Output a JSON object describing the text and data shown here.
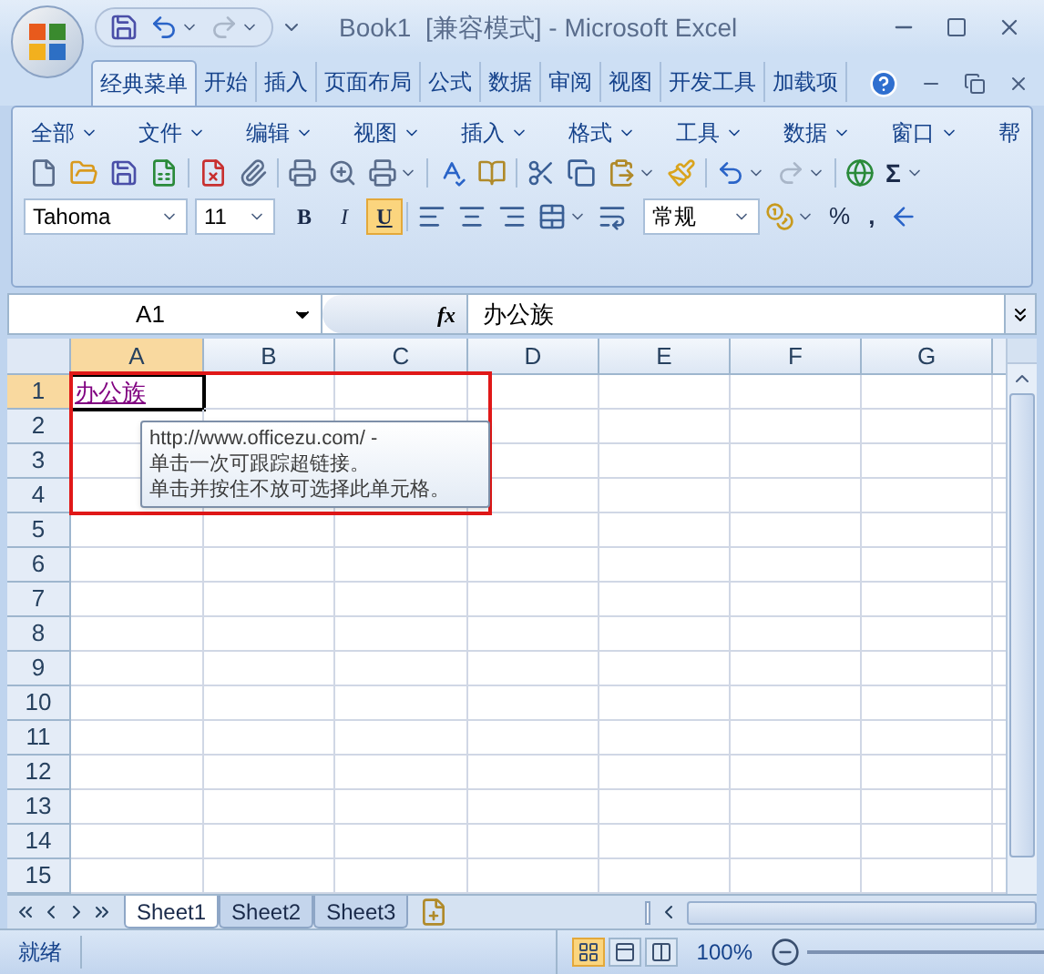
{
  "window": {
    "title": "Book1  [兼容模式] - Microsoft Excel"
  },
  "ribbon_tabs": [
    {
      "label": "经典菜单",
      "selected": true
    },
    {
      "label": "开始",
      "selected": false
    },
    {
      "label": "插入",
      "selected": false
    },
    {
      "label": "页面布局",
      "selected": false
    },
    {
      "label": "公式",
      "selected": false
    },
    {
      "label": "数据",
      "selected": false
    },
    {
      "label": "审阅",
      "selected": false
    },
    {
      "label": "视图",
      "selected": false
    },
    {
      "label": "开发工具",
      "selected": false
    },
    {
      "label": "加载项",
      "selected": false
    }
  ],
  "menu": [
    "全部",
    "文件",
    "编辑",
    "视图",
    "插入",
    "格式",
    "工具",
    "数据",
    "窗口",
    "帮"
  ],
  "font": {
    "name": "Tahoma",
    "size": "11"
  },
  "format_buttons": [
    {
      "label": "B",
      "on": false
    },
    {
      "label": "I",
      "on": false
    },
    {
      "label": "U",
      "on": true
    }
  ],
  "number_format": "常规",
  "symbols": {
    "sum": "Σ",
    "percent": "%",
    "comma": ","
  },
  "formula_bar": {
    "name_box": "A1",
    "fx": "fx",
    "value": "办公族"
  },
  "columns": [
    {
      "label": "A",
      "selected": true
    },
    {
      "label": "B",
      "selected": false
    },
    {
      "label": "C",
      "selected": false
    },
    {
      "label": "D",
      "selected": false
    },
    {
      "label": "E",
      "selected": false
    },
    {
      "label": "F",
      "selected": false
    },
    {
      "label": "G",
      "selected": false
    }
  ],
  "rows": [
    {
      "label": "1",
      "selected": true
    },
    {
      "label": "2",
      "selected": false
    },
    {
      "label": "3",
      "selected": false
    },
    {
      "label": "4",
      "selected": false
    },
    {
      "label": "5",
      "selected": false
    },
    {
      "label": "6",
      "selected": false
    },
    {
      "label": "7",
      "selected": false
    },
    {
      "label": "8",
      "selected": false
    },
    {
      "label": "9",
      "selected": false
    },
    {
      "label": "10",
      "selected": false
    },
    {
      "label": "11",
      "selected": false
    },
    {
      "label": "12",
      "selected": false
    },
    {
      "label": "13",
      "selected": false
    },
    {
      "label": "14",
      "selected": false
    },
    {
      "label": "15",
      "selected": false
    }
  ],
  "cell_a1": {
    "text": "办公族",
    "kind": "link"
  },
  "tooltip": {
    "lines": [
      "http://www.officezu.com/ -",
      "单击一次可跟踪超链接。",
      "单击并按住不放可选择此单元格。"
    ]
  },
  "sheet_tabs": [
    {
      "label": "Sheet1",
      "selected": true
    },
    {
      "label": "Sheet2",
      "selected": false
    },
    {
      "label": "Sheet3",
      "selected": false
    }
  ],
  "status_bar": {
    "text": "就绪",
    "zoom": "100%",
    "views": [
      {
        "selected": true
      },
      {
        "selected": false
      },
      {
        "selected": false
      }
    ]
  }
}
